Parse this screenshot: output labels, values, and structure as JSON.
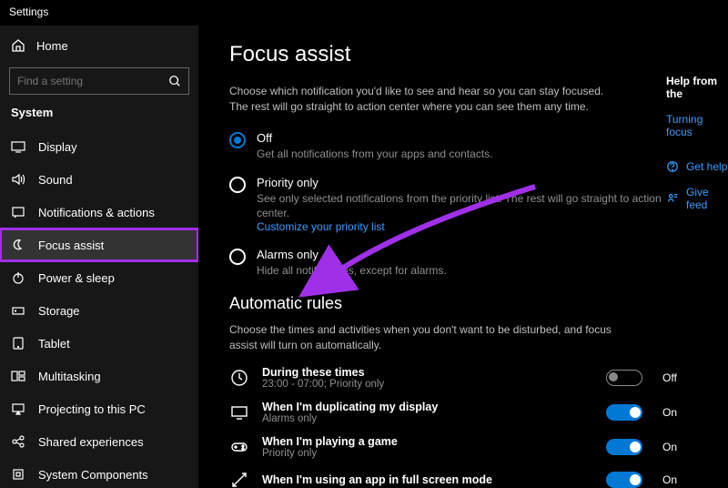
{
  "titlebar": "Settings",
  "sidebar": {
    "home": "Home",
    "search_placeholder": "Find a setting",
    "section": "System",
    "items": [
      {
        "label": "Display"
      },
      {
        "label": "Sound"
      },
      {
        "label": "Notifications & actions"
      },
      {
        "label": "Focus assist"
      },
      {
        "label": "Power & sleep"
      },
      {
        "label": "Storage"
      },
      {
        "label": "Tablet"
      },
      {
        "label": "Multitasking"
      },
      {
        "label": "Projecting to this PC"
      },
      {
        "label": "Shared experiences"
      },
      {
        "label": "System Components"
      }
    ]
  },
  "main": {
    "title": "Focus assist",
    "intro": "Choose which notification you'd like to see and hear so you can stay focused. The rest will go straight to action center where you can see them any time.",
    "radios": {
      "off": {
        "title": "Off",
        "sub": "Get all notifications from your apps and contacts."
      },
      "priority": {
        "title": "Priority only",
        "sub": "See only selected notifications from the priority list. The rest will go straight to action center.",
        "link": "Customize your priority list"
      },
      "alarms": {
        "title": "Alarms only",
        "sub": "Hide all notifications, except for alarms."
      }
    },
    "auto": {
      "heading": "Automatic rules",
      "intro": "Choose the times and activities when you don't want to be disturbed, and focus assist will turn on automatically.",
      "rules": [
        {
          "title": "During these times",
          "sub": "23:00 - 07:00; Priority only",
          "state": "Off"
        },
        {
          "title": "When I'm duplicating my display",
          "sub": "Alarms only",
          "state": "On"
        },
        {
          "title": "When I'm playing a game",
          "sub": "Priority only",
          "state": "On"
        },
        {
          "title": "When I'm using an app in full screen mode",
          "sub": "",
          "state": "On"
        }
      ]
    }
  },
  "right": {
    "heading": "Help from the",
    "link": "Turning focus",
    "help": "Get help",
    "feedback": "Give feed"
  }
}
